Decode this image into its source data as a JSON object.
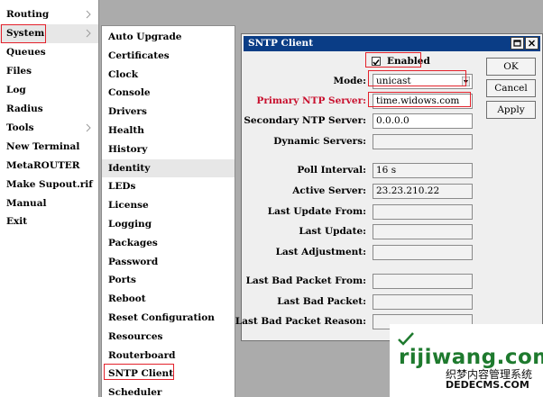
{
  "main_menu": {
    "items": [
      {
        "label": "Routing",
        "has_submenu": true
      },
      {
        "label": "System",
        "has_submenu": true,
        "active": true
      },
      {
        "label": "Queues",
        "has_submenu": false
      },
      {
        "label": "Files",
        "has_submenu": false
      },
      {
        "label": "Log",
        "has_submenu": false
      },
      {
        "label": "Radius",
        "has_submenu": false
      },
      {
        "label": "Tools",
        "has_submenu": true
      },
      {
        "label": "New Terminal",
        "has_submenu": false
      },
      {
        "label": "MetaROUTER",
        "has_submenu": false
      },
      {
        "label": "Make Supout.rif",
        "has_submenu": false
      },
      {
        "label": "Manual",
        "has_submenu": false
      },
      {
        "label": "Exit",
        "has_submenu": false
      }
    ]
  },
  "submenu": {
    "items": [
      {
        "label": "Auto Upgrade"
      },
      {
        "label": "Certificates"
      },
      {
        "label": "Clock"
      },
      {
        "label": "Console"
      },
      {
        "label": "Drivers"
      },
      {
        "label": "Health"
      },
      {
        "label": "History"
      },
      {
        "label": "Identity",
        "active": true
      },
      {
        "label": "LEDs"
      },
      {
        "label": "License"
      },
      {
        "label": "Logging"
      },
      {
        "label": "Packages"
      },
      {
        "label": "Password"
      },
      {
        "label": "Ports"
      },
      {
        "label": "Reboot"
      },
      {
        "label": "Reset Configuration"
      },
      {
        "label": "Resources"
      },
      {
        "label": "Routerboard"
      },
      {
        "label": "SNTP Client"
      },
      {
        "label": "Scheduler"
      }
    ]
  },
  "dialog": {
    "title": "SNTP Client",
    "enabled": {
      "label": "Enabled",
      "checked": true
    },
    "fields": {
      "mode": {
        "label": "Mode:",
        "value": "unicast"
      },
      "primary_ntp": {
        "label": "Primary NTP Server:",
        "value": "time.widows.com"
      },
      "secondary_ntp": {
        "label": "Secondary NTP Server:",
        "value": "0.0.0.0"
      },
      "dynamic_servers": {
        "label": "Dynamic Servers:",
        "value": ""
      },
      "poll_interval": {
        "label": "Poll Interval:",
        "value": "16 s"
      },
      "active_server": {
        "label": "Active Server:",
        "value": "23.23.210.22"
      },
      "last_update_from": {
        "label": "Last Update From:",
        "value": ""
      },
      "last_update": {
        "label": "Last Update:",
        "value": ""
      },
      "last_adjustment": {
        "label": "Last Adjustment:",
        "value": ""
      },
      "last_bad_packet_from": {
        "label": "Last Bad Packet From:",
        "value": ""
      },
      "last_bad_packet": {
        "label": "Last Bad Packet:",
        "value": ""
      },
      "last_bad_packet_reason": {
        "label": "Last Bad Packet Reason:",
        "value": ""
      }
    },
    "buttons": {
      "ok": "OK",
      "cancel": "Cancel",
      "apply": "Apply"
    }
  },
  "watermark": {
    "main": "rijiwang.com",
    "sub1": "织梦内容管理系统",
    "sub2": "DEDECMS.COM"
  },
  "colors": {
    "titlebar": "#0a3d86",
    "highlight_box": "#e3212b",
    "required_label": "#c8102e",
    "watermark": "#1e7a2e"
  }
}
